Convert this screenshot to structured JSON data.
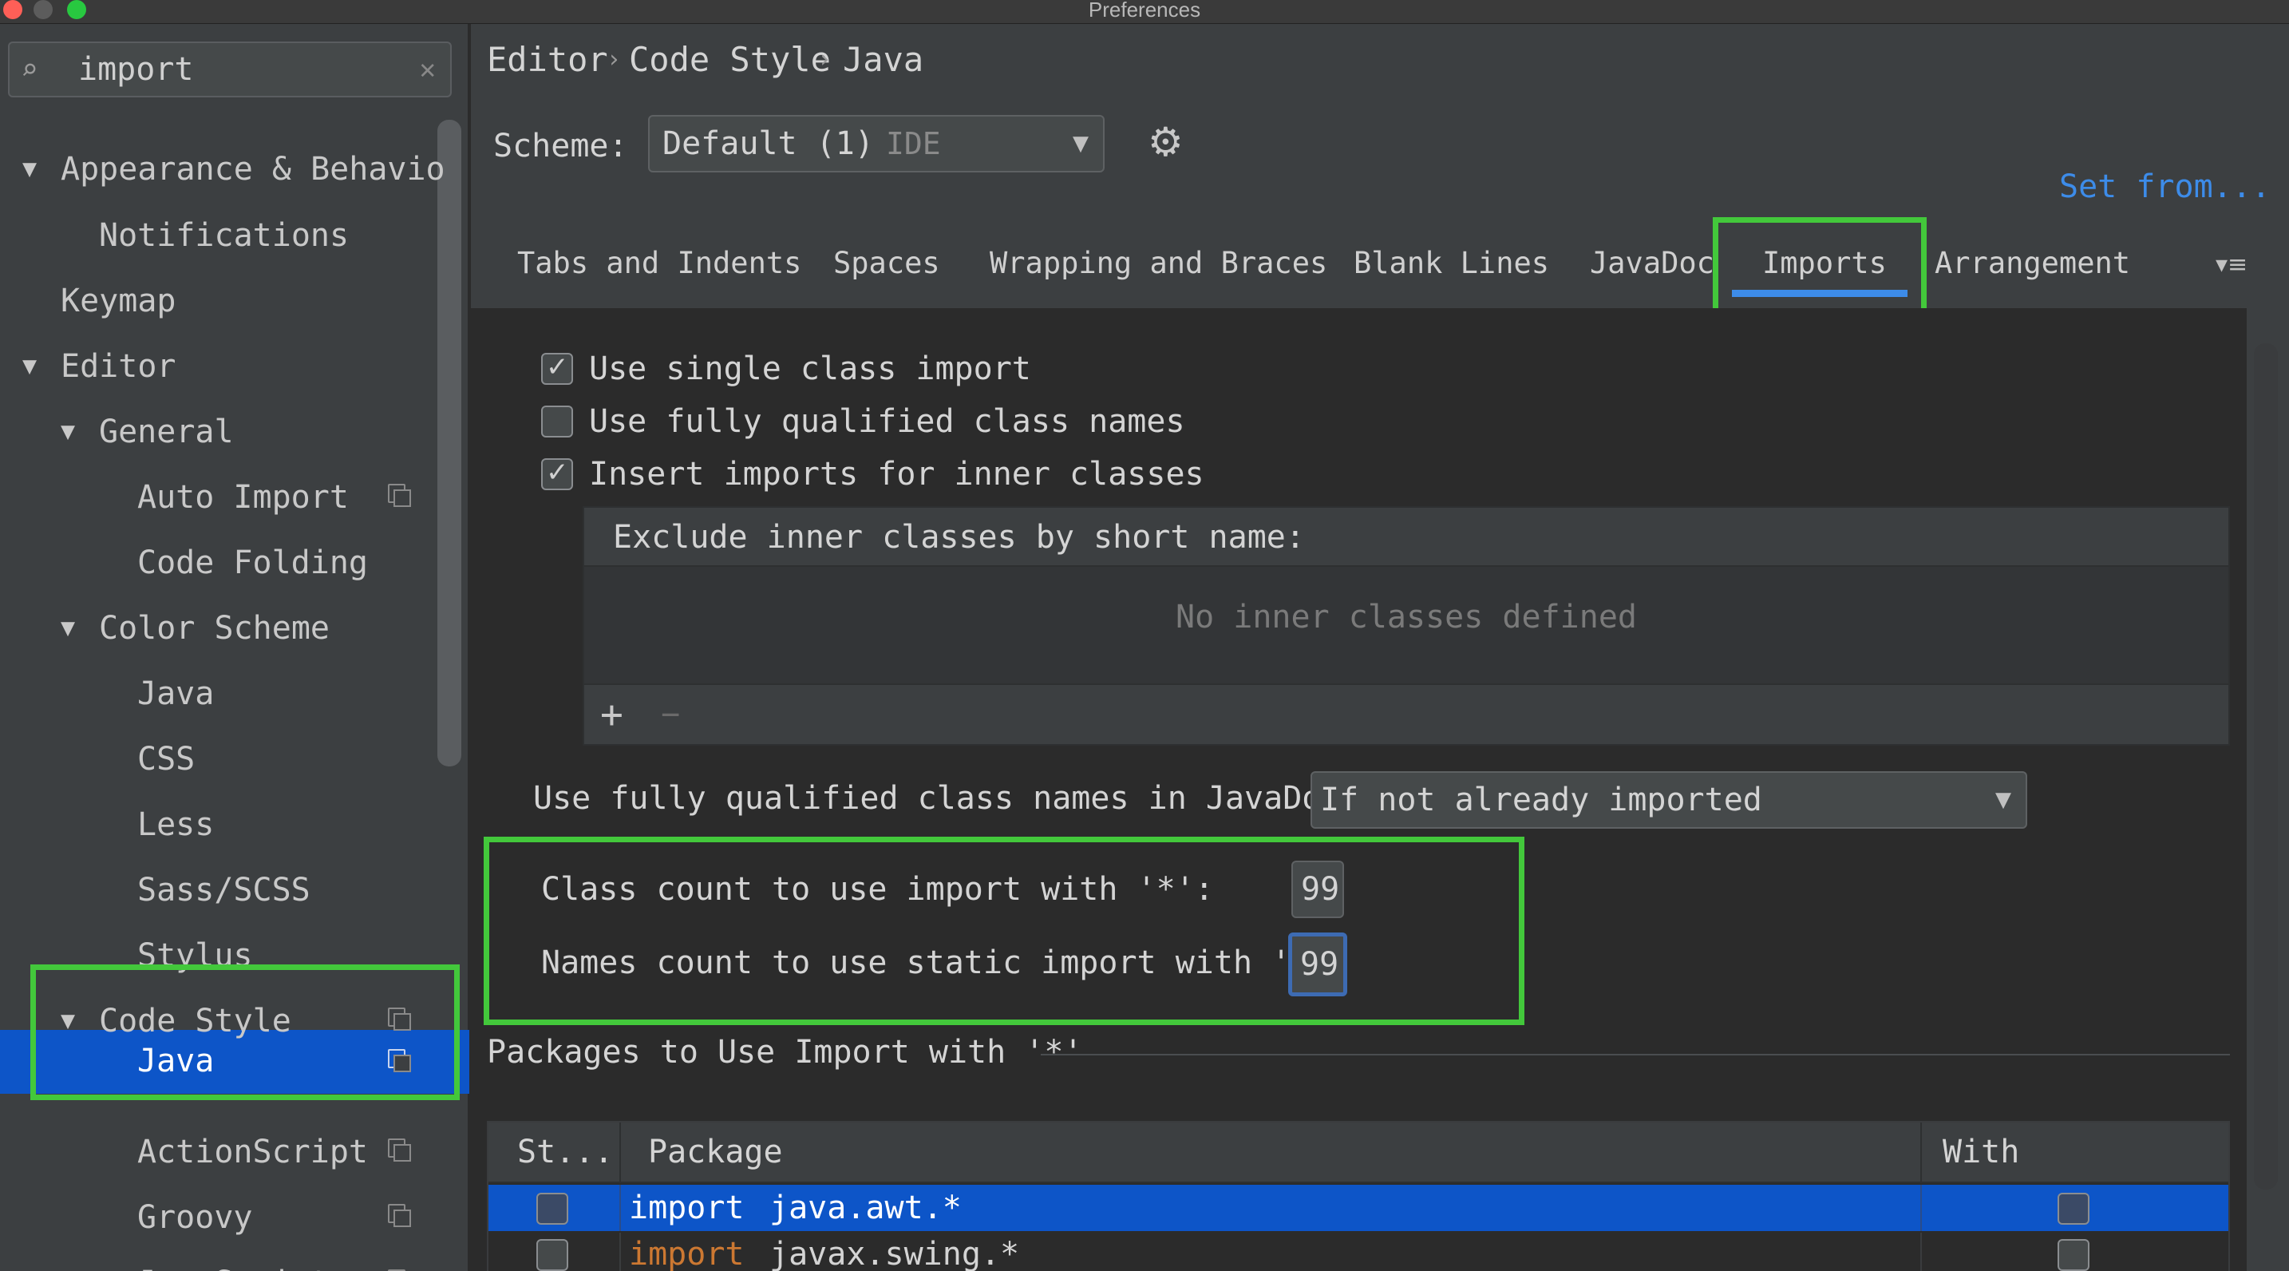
{
  "window": {
    "title": "Preferences",
    "traffic_lights": [
      "#fe5f57",
      "#febc2e",
      "#28c840"
    ]
  },
  "search": {
    "value": "import",
    "icon": "search-icon",
    "clear_icon": "clear-icon"
  },
  "sidebar": {
    "items": [
      {
        "label": "Appearance & Behavio",
        "expanded": true
      },
      {
        "label": "Notifications"
      },
      {
        "label": "Keymap"
      },
      {
        "label": "Editor",
        "expanded": true
      },
      {
        "label": "General",
        "expanded": true
      },
      {
        "label": "Auto Import"
      },
      {
        "label": "Code Folding"
      },
      {
        "label": "Color Scheme",
        "expanded": true
      },
      {
        "label": "Java"
      },
      {
        "label": "CSS"
      },
      {
        "label": "Less"
      },
      {
        "label": "Sass/SCSS"
      },
      {
        "label": "Stylus"
      },
      {
        "label": "Code Style",
        "expanded": true
      },
      {
        "label": "Java",
        "selected": true
      },
      {
        "label": "ActionScript"
      },
      {
        "label": "Groovy"
      },
      {
        "label": "JavaScript"
      }
    ]
  },
  "breadcrumb": {
    "items": [
      "Editor",
      "Code Style",
      "Java"
    ],
    "separator": "›"
  },
  "scheme": {
    "label": "Scheme:",
    "value": "Default (1)",
    "suffix": "IDE"
  },
  "set_from": "Set from...",
  "tabs": [
    {
      "label": "Tabs and Indents"
    },
    {
      "label": "Spaces"
    },
    {
      "label": "Wrapping and Braces"
    },
    {
      "label": "Blank Lines"
    },
    {
      "label": "JavaDoc"
    },
    {
      "label": "Imports",
      "active": true
    },
    {
      "label": "Arrangement"
    }
  ],
  "options": {
    "single_class_import": {
      "label": "Use single class import",
      "checked": true
    },
    "fully_qualified": {
      "label": "Use fully qualified class names",
      "checked": false
    },
    "inner_classes": {
      "label": "Insert imports for inner classes",
      "checked": true
    }
  },
  "exclude_panel": {
    "header": "Exclude inner classes by short name:",
    "empty_text": "No inner classes defined",
    "add": "+",
    "remove": "−"
  },
  "javadoc": {
    "label": "Use fully qualified class names in JavaDoc:",
    "value": "If not already imported"
  },
  "counts": {
    "class_label": "Class count to use import with '*':",
    "class_value": "99",
    "names_label": "Names count to use static import with '*':",
    "names_value": "99"
  },
  "packages": {
    "title": "Packages to Use Import with '*'",
    "columns": [
      "St...",
      "Package",
      "With Subpack..."
    ],
    "rows": [
      {
        "keyword": "import",
        "package": "java.awt.*",
        "static": false,
        "with_subpackages": false,
        "selected": true
      },
      {
        "keyword": "import",
        "package": "javax.swing.*",
        "static": false,
        "with_subpackages": false,
        "selected": false
      }
    ]
  },
  "colors": {
    "selection": "#0d55c8",
    "highlight_box": "#43c83b",
    "link": "#3d8ce9",
    "keyword": "#cc7832"
  }
}
